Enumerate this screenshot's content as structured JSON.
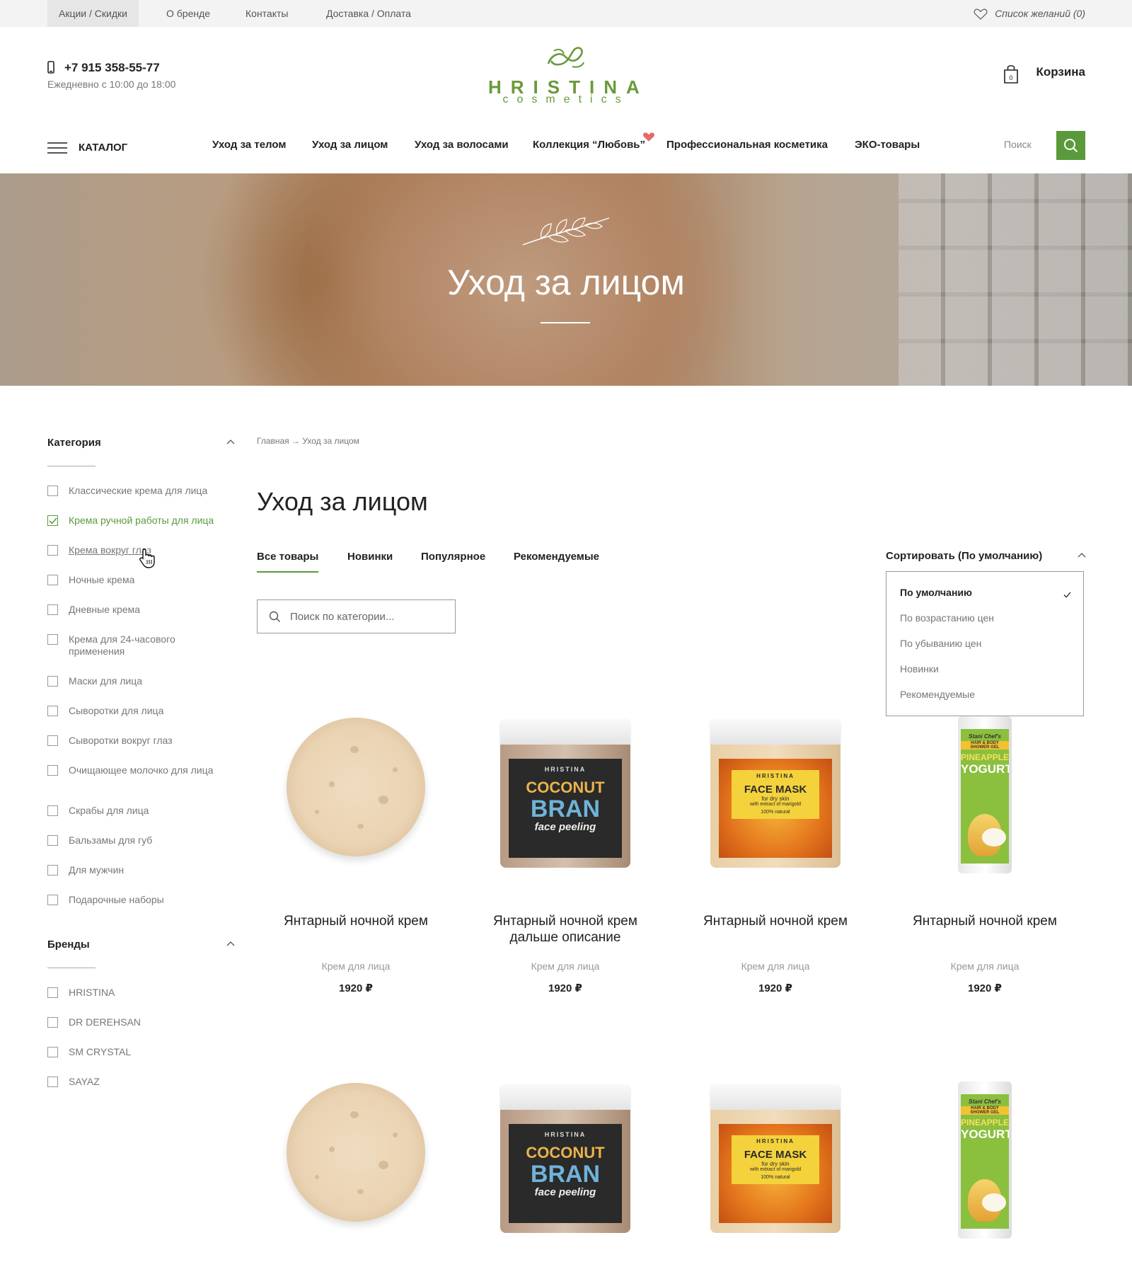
{
  "topbar": {
    "links": [
      "Акции / Скидки",
      "О бренде",
      "Контакты",
      "Доставка / Оплата"
    ],
    "wishlist": "Список желаний (0)"
  },
  "header": {
    "phone": "+7 915 358-55-77",
    "hours": "Ежедневно с 10:00 до 18:00",
    "logo_brand": "HRISTINA",
    "logo_sub": "cosmetics",
    "cart_label": "Корзина",
    "cart_count": "0"
  },
  "nav": {
    "catalog": "КАТАЛОГ",
    "items": [
      "Уход за телом",
      "Уход за лицом",
      "Уход за волосами",
      "Коллекция “Любовь”",
      "Профессиональная косметика",
      "ЭКО-товары"
    ],
    "search": "Поиск"
  },
  "hero": {
    "title": "Уход за лицом"
  },
  "sidebar": {
    "category_title": "Категория",
    "categories": [
      "Классические крема для лица",
      "Крема ручной работы для лица",
      "Крема вокруг глаз",
      "Ночные крема",
      "Дневные крема",
      "Крема для 24-часового применения",
      "Маски для лица",
      "Сыворотки для лица",
      "Сыворотки вокруг глаз",
      "Очищающее молочко для лица",
      "Скрабы для лица",
      "Бальзамы для губ",
      "Для мужчин",
      "Подарочные наборы"
    ],
    "checked_category": "Крема ручной работы для лица",
    "brands_title": "Бренды",
    "brands": [
      "HRISTINA",
      "DR DEREHSAN",
      "SM CRYSTAL",
      "SAYAZ"
    ]
  },
  "main": {
    "breadcrumb": "Главная → Уход за лицом",
    "title": "Уход за лицом",
    "tabs": [
      "Все товары",
      "Новинки",
      "Популярное",
      "Рекомендуемые"
    ],
    "sort_label": "Сортировать (По умолчанию)",
    "sort_options": [
      "По умолчанию",
      "По возрастанию цен",
      "По убыванию цен",
      "Новинки",
      "Рекомендуемые"
    ],
    "search_placeholder": "Поиск по категории..."
  },
  "products": [
    {
      "name": "Янтарный ночной крем",
      "category": "Крем для лица",
      "price": "1920 ₽",
      "image": "cream-dish"
    },
    {
      "name": "Янтарный ночной крем дальше описание",
      "category": "Крем для лица",
      "price": "1920 ₽",
      "image": "coconut-bran-jar"
    },
    {
      "name": "Янтарный ночной крем",
      "category": "Крем для лица",
      "price": "1920 ₽",
      "image": "face-mask-jar"
    },
    {
      "name": "Янтарный ночной крем",
      "category": "Крем для лица",
      "price": "1920 ₽",
      "image": "pineapple-yogurt-bottle"
    },
    {
      "image": "cream-dish"
    },
    {
      "image": "coconut-bran-jar"
    },
    {
      "image": "face-mask-jar"
    },
    {
      "image": "pineapple-yogurt-bottle"
    }
  ],
  "product_labels": {
    "coconut": [
      "HRISTINA",
      "COCONUT",
      "BRAN",
      "face peeling"
    ],
    "mask": [
      "HRISTINA",
      "FACE MASK",
      "for dry skin",
      "with extract of marigold",
      "100% natural"
    ],
    "yogurt": [
      "Stani Chef's",
      "HAIR & BODY SHOWER GEL",
      "PINEAPPLE",
      "YOGURT"
    ]
  },
  "colors": {
    "accent": "#5a9a3a",
    "heart": "#e8676b"
  }
}
